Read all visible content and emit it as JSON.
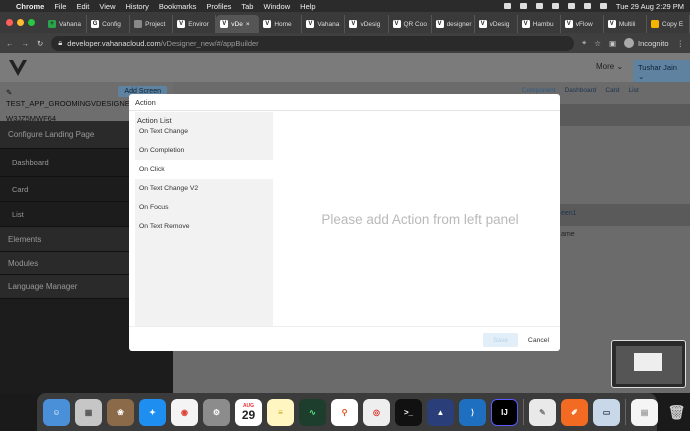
{
  "menubar": {
    "app": "Chrome",
    "items": [
      "File",
      "Edit",
      "View",
      "History",
      "Bookmarks",
      "Profiles",
      "Tab",
      "Window",
      "Help"
    ],
    "clock": "Tue 29 Aug  2:29 PM"
  },
  "tabs": [
    {
      "label": "Vahana",
      "fav": "+",
      "color": "#2aa34a"
    },
    {
      "label": "Config",
      "fav": "G",
      "color": "#ffffff"
    },
    {
      "label": "Project",
      "fav": "",
      "color": "#888888"
    },
    {
      "label": "Enviror",
      "fav": "V",
      "color": "#ffffff"
    },
    {
      "label": "vDe",
      "fav": "V",
      "color": "#ffffff",
      "active": true
    },
    {
      "label": "Home",
      "fav": "V",
      "color": "#ffffff"
    },
    {
      "label": "Vahana",
      "fav": "V",
      "color": "#ffffff"
    },
    {
      "label": "vDesig",
      "fav": "V",
      "color": "#ffffff"
    },
    {
      "label": "QR Coo",
      "fav": "V",
      "color": "#ffffff"
    },
    {
      "label": "designer",
      "fav": "V",
      "color": "#ffffff"
    },
    {
      "label": "vDesig",
      "fav": "V",
      "color": "#ffffff"
    },
    {
      "label": "Hambu",
      "fav": "V",
      "color": "#ffffff"
    },
    {
      "label": "vFlow",
      "fav": "V",
      "color": "#ffffff"
    },
    {
      "label": "Multili",
      "fav": "V",
      "color": "#ffffff"
    },
    {
      "label": "Copy E",
      "fav": "",
      "color": "#f5b400"
    }
  ],
  "address": {
    "host": "developer.vahanacloud.com",
    "path": "/vDesigner_new/#/appBuilder",
    "incognito": "Incognito"
  },
  "app_header": {
    "more": "More",
    "user": "Tushar Jain"
  },
  "sidebar": {
    "add_screen": "Add Screen",
    "app_name": "TEST_APP_GROOMINGVDESIGNE...",
    "app_id": "W3JZ5MWF64",
    "sections": [
      {
        "label": "Configure Landing Page",
        "kind": "section"
      },
      {
        "label": "Dashboard",
        "kind": "sub"
      },
      {
        "label": "Card",
        "kind": "sub"
      },
      {
        "label": "List",
        "kind": "sub"
      },
      {
        "label": "Elements",
        "kind": "section"
      },
      {
        "label": "Modules",
        "kind": "section"
      },
      {
        "label": "Language Manager",
        "kind": "section"
      }
    ]
  },
  "right_tabs": [
    "Component",
    "Dashboard",
    "Card",
    "List"
  ],
  "right_panel": {
    "screen_text": "een1",
    "name_text": "ame"
  },
  "modal": {
    "title": "Action",
    "list_title": "Action List",
    "actions": [
      "On Text Change",
      "On Completion",
      "On Click",
      "On Text Change V2",
      "On Focus",
      "On Text Remove"
    ],
    "placeholder": "Please add Action from left panel",
    "save": "Save",
    "cancel": "Cancel"
  },
  "dock": {
    "calendar_month": "AUG",
    "calendar_day": "29"
  }
}
